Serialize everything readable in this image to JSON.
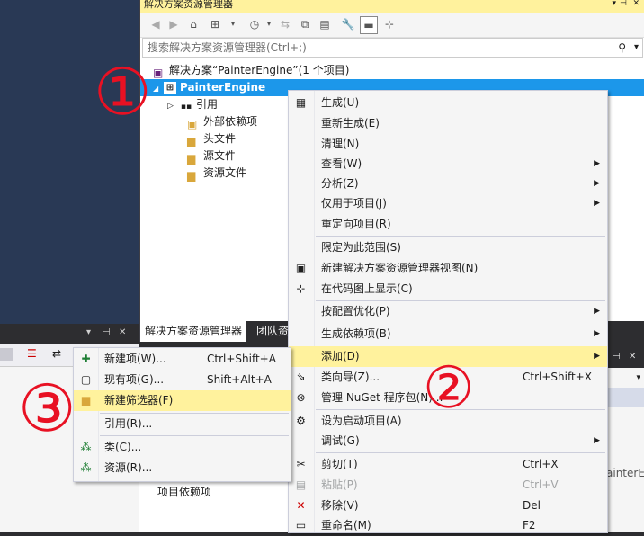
{
  "solution_explorer": {
    "title": "解决方案资源管理器",
    "search_placeholder": "搜索解决方案资源管理器(Ctrl+;)",
    "tree": {
      "solution": "解决方案“PainterEngine”(1 个项目)",
      "project": "PainterEngine",
      "items": [
        "引用",
        "外部依赖项",
        "头文件",
        "源文件",
        "资源文件"
      ]
    },
    "tabs": [
      "解决方案资源管理器",
      "团队资源"
    ]
  },
  "context_menu": {
    "items": [
      {
        "label": "生成(U)",
        "icon": "build-icon"
      },
      {
        "label": "重新生成(E)"
      },
      {
        "label": "清理(N)"
      },
      {
        "label": "查看(W)",
        "submenu": true
      },
      {
        "label": "分析(Z)",
        "submenu": true
      },
      {
        "label": "仅用于项目(J)",
        "submenu": true
      },
      {
        "label": "重定向项目(R)"
      },
      {
        "label": "限定为此范围(S)"
      },
      {
        "label": "新建解决方案资源管理器视图(N)",
        "icon": "new-view-icon"
      },
      {
        "label": "在代码图上显示(C)",
        "icon": "code-map-icon"
      },
      {
        "label": "按配置优化(P)",
        "submenu": true
      },
      {
        "label": "生成依赖项(B)",
        "submenu": true
      },
      {
        "label": "添加(D)",
        "submenu": true,
        "highlighted": true
      },
      {
        "label": "类向导(Z)...",
        "shortcut": "Ctrl+Shift+X",
        "icon": "class-wizard-icon"
      },
      {
        "label": "管理 NuGet 程序包(N)...",
        "icon": "nuget-icon"
      },
      {
        "label": "设为启动项目(A)",
        "icon": "gear-icon"
      },
      {
        "label": "调试(G)",
        "submenu": true
      },
      {
        "label": "剪切(T)",
        "shortcut": "Ctrl+X",
        "icon": "scissors-icon"
      },
      {
        "label": "粘贴(P)",
        "shortcut": "Ctrl+V",
        "icon": "paste-icon",
        "disabled": true
      },
      {
        "label": "移除(V)",
        "shortcut": "Del",
        "icon": "remove-icon"
      },
      {
        "label": "重命名(M)",
        "shortcut": "F2",
        "icon": "rename-icon"
      }
    ]
  },
  "add_submenu": {
    "items": [
      {
        "label": "新建项(W)...",
        "shortcut": "Ctrl+Shift+A",
        "icon": "new-item-icon"
      },
      {
        "label": "现有项(G)...",
        "shortcut": "Shift+Alt+A",
        "icon": "existing-item-icon"
      },
      {
        "label": "新建筛选器(F)",
        "icon": "folder-icon",
        "highlighted": true
      },
      {
        "label": "引用(R)..."
      },
      {
        "label": "类(C)...",
        "icon": "class-icon"
      },
      {
        "label": "资源(R)...",
        "icon": "resource-icon"
      }
    ]
  },
  "bottom_left": {
    "header_glyphs": "▾ ⊣ ✕"
  },
  "properties_fragment": {
    "text": "ainterEr"
  },
  "project_deps_label": "项目依赖项",
  "annotations": [
    "①",
    "②",
    "③"
  ],
  "colors": {
    "selection": "#1c97ea",
    "highlight": "#fff29d",
    "annotation": "#e81123"
  }
}
